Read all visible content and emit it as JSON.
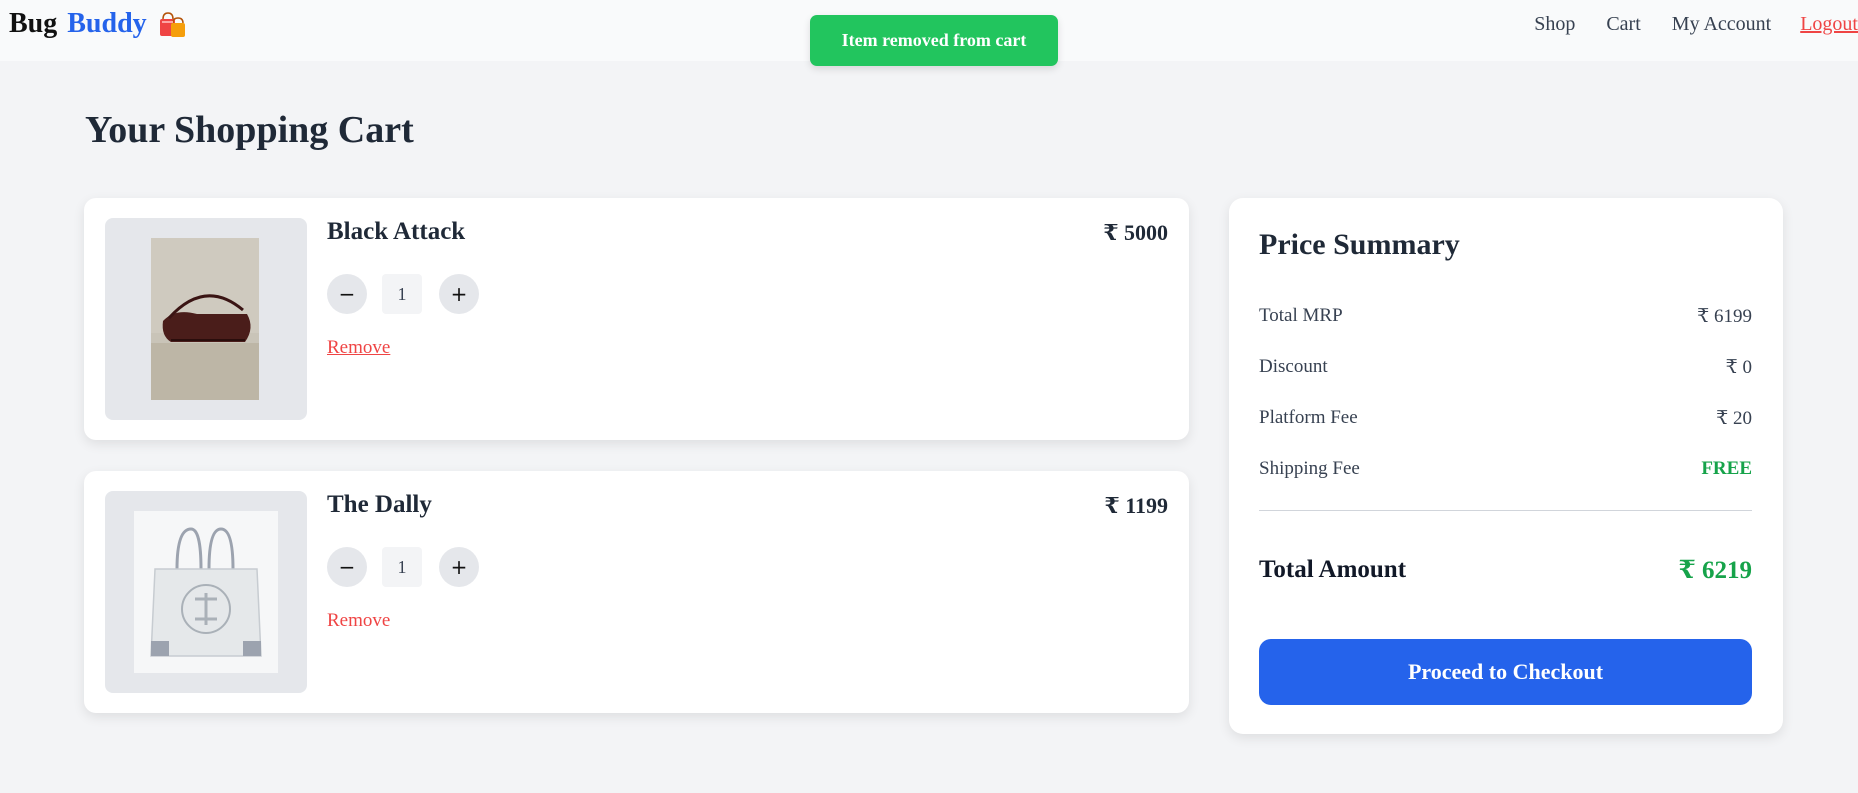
{
  "navbar": {
    "logo_part1": "Bug",
    "logo_part2": "Buddy",
    "logo_icon": "shopping-bags-icon",
    "links": [
      "Shop",
      "Cart",
      "My Account",
      "Logout"
    ]
  },
  "toast": {
    "message": "Item removed from cart",
    "color": "#22c55e"
  },
  "page_title": "Your Shopping Cart",
  "cart_items": [
    {
      "name": "Black Attack",
      "price": "₹ 5000",
      "quantity": "1",
      "remove_label": "Remove",
      "image": "black-shoulder-bag-image"
    },
    {
      "name": "The Dally",
      "price": "₹ 1199",
      "quantity": "1",
      "remove_label": "Remove",
      "image": "white-tote-bag-image"
    }
  ],
  "summary": {
    "title": "Price Summary",
    "rows": [
      {
        "label": "Total MRP",
        "value": "₹ 6199"
      },
      {
        "label": "Discount",
        "value": "₹ 0"
      },
      {
        "label": "Platform Fee",
        "value": "₹ 20"
      },
      {
        "label": "Shipping Fee",
        "value": "FREE"
      }
    ],
    "total_label": "Total Amount",
    "total_value": "₹ 6219",
    "checkout_label": "Proceed to Checkout"
  },
  "colors": {
    "accent": "#2563eb",
    "success": "#16a34a",
    "danger": "#ef4444",
    "background": "#f3f4f6"
  }
}
